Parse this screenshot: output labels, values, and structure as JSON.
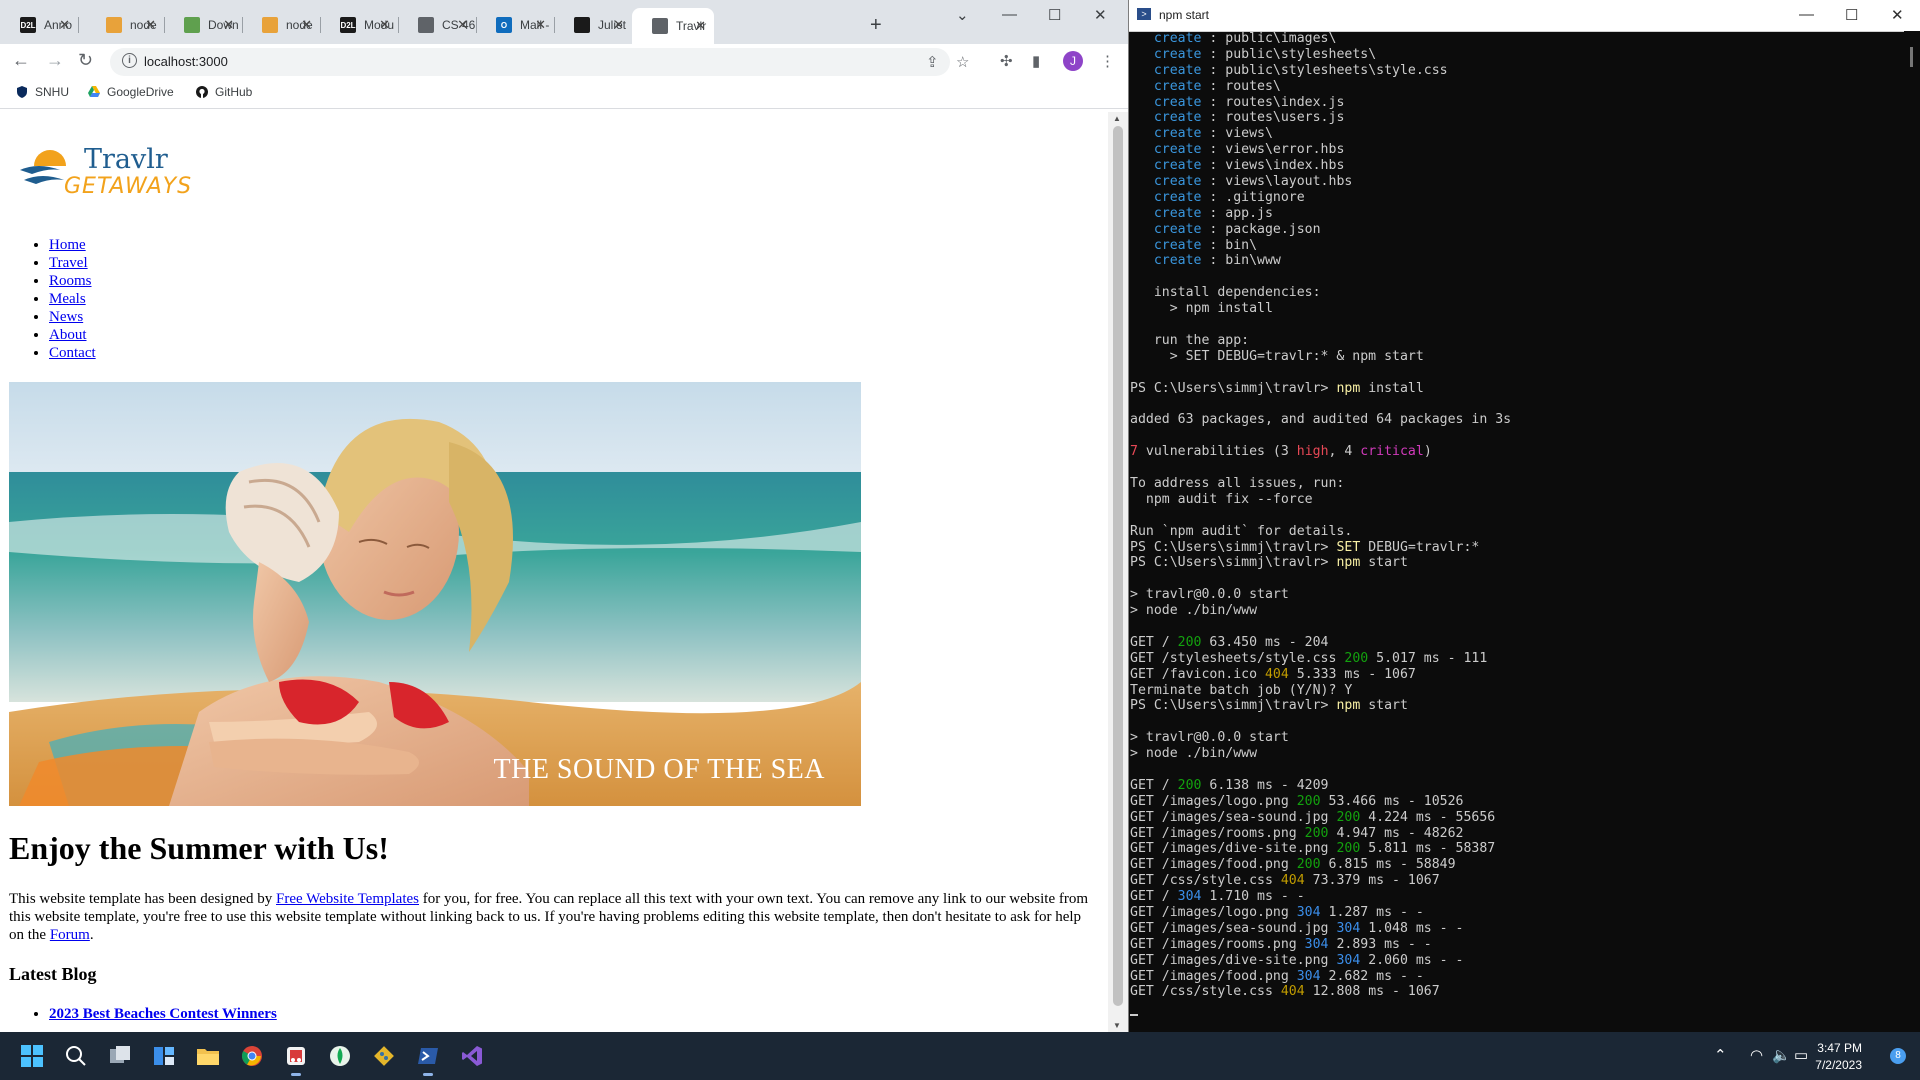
{
  "browser": {
    "tabs": [
      {
        "title": "Anno",
        "icon": "d2l-icon",
        "icon_text": "D2L",
        "icon_color": "#1a1a1a"
      },
      {
        "title": "node",
        "icon": "node-icon",
        "icon_text": "",
        "icon_color": "#e8a23a"
      },
      {
        "title": "Down",
        "icon": "nodejs-hex-icon",
        "icon_text": "",
        "icon_color": "#5fa04e"
      },
      {
        "title": "node",
        "icon": "node-icon",
        "icon_text": "",
        "icon_color": "#e8a23a"
      },
      {
        "title": "Modu",
        "icon": "d2l-icon",
        "icon_text": "D2L",
        "icon_color": "#1a1a1a"
      },
      {
        "title": "CS 46",
        "icon": "globe-icon",
        "icon_text": "",
        "icon_color": "#5f6368"
      },
      {
        "title": "Mail -",
        "icon": "outlook-icon",
        "icon_text": "O",
        "icon_color": "#0f6cbd"
      },
      {
        "title": "Juliet",
        "icon": "github-icon",
        "icon_text": "",
        "icon_color": "#1a1a1a"
      },
      {
        "title": "Travlr",
        "icon": "globe-icon",
        "icon_text": "",
        "icon_color": "#5f6368",
        "active": true
      }
    ],
    "url": "localhost:3000",
    "profile_initial": "J",
    "bookmarks": [
      {
        "label": "SNHU",
        "icon": "snhu-shield-icon"
      },
      {
        "label": "GoogleDrive",
        "icon": "google-drive-icon"
      },
      {
        "label": "GitHub",
        "icon": "github-icon"
      }
    ]
  },
  "page": {
    "logo_top": "Travlr",
    "logo_bottom": "GETAWAYS",
    "nav": [
      "Home",
      "Travel",
      "Rooms",
      "Meals",
      "News",
      "About",
      "Contact"
    ],
    "hero_caption": "THE SOUND OF THE SEA",
    "heading": "Enjoy the Summer with Us!",
    "intro_before_link": "This website template has been designed by ",
    "intro_link": "Free Website Templates",
    "intro_middle": " for you, for free. You can replace all this text with your own text. You can remove any link to our website from this website template, you're free to use this website template without linking back to us. If you're having problems editing this website template, then don't hesitate to ask for help on the ",
    "intro_link2": "Forum",
    "intro_end": ".",
    "latest_blog": "Latest Blog",
    "blog_items": [
      "2023 Best Beaches Contest Winners"
    ]
  },
  "terminal": {
    "title": "npm start",
    "lines": [
      [
        {
          "t": "   "
        },
        {
          "t": "create",
          "c": "c-cyan"
        },
        {
          "t": " : public\\images\\"
        }
      ],
      [
        {
          "t": "   "
        },
        {
          "t": "create",
          "c": "c-cyan"
        },
        {
          "t": " : public\\stylesheets\\"
        }
      ],
      [
        {
          "t": "   "
        },
        {
          "t": "create",
          "c": "c-cyan"
        },
        {
          "t": " : public\\stylesheets\\style.css"
        }
      ],
      [
        {
          "t": "   "
        },
        {
          "t": "create",
          "c": "c-cyan"
        },
        {
          "t": " : routes\\"
        }
      ],
      [
        {
          "t": "   "
        },
        {
          "t": "create",
          "c": "c-cyan"
        },
        {
          "t": " : routes\\index.js"
        }
      ],
      [
        {
          "t": "   "
        },
        {
          "t": "create",
          "c": "c-cyan"
        },
        {
          "t": " : routes\\users.js"
        }
      ],
      [
        {
          "t": "   "
        },
        {
          "t": "create",
          "c": "c-cyan"
        },
        {
          "t": " : views\\"
        }
      ],
      [
        {
          "t": "   "
        },
        {
          "t": "create",
          "c": "c-cyan"
        },
        {
          "t": " : views\\error.hbs"
        }
      ],
      [
        {
          "t": "   "
        },
        {
          "t": "create",
          "c": "c-cyan"
        },
        {
          "t": " : views\\index.hbs"
        }
      ],
      [
        {
          "t": "   "
        },
        {
          "t": "create",
          "c": "c-cyan"
        },
        {
          "t": " : views\\layout.hbs"
        }
      ],
      [
        {
          "t": "   "
        },
        {
          "t": "create",
          "c": "c-cyan"
        },
        {
          "t": " : .gitignore"
        }
      ],
      [
        {
          "t": "   "
        },
        {
          "t": "create",
          "c": "c-cyan"
        },
        {
          "t": " : app.js"
        }
      ],
      [
        {
          "t": "   "
        },
        {
          "t": "create",
          "c": "c-cyan"
        },
        {
          "t": " : package.json"
        }
      ],
      [
        {
          "t": "   "
        },
        {
          "t": "create",
          "c": "c-cyan"
        },
        {
          "t": " : bin\\"
        }
      ],
      [
        {
          "t": "   "
        },
        {
          "t": "create",
          "c": "c-cyan"
        },
        {
          "t": " : bin\\www"
        }
      ],
      [
        {
          "t": ""
        }
      ],
      [
        {
          "t": "   install dependencies:"
        }
      ],
      [
        {
          "t": "     > npm install"
        }
      ],
      [
        {
          "t": ""
        }
      ],
      [
        {
          "t": "   run the app:"
        }
      ],
      [
        {
          "t": "     > SET DEBUG=travlr:* & npm start"
        }
      ],
      [
        {
          "t": ""
        }
      ],
      [
        {
          "t": "PS C:\\Users\\simmj\\travlr> "
        },
        {
          "t": "npm",
          "c": "c-yellow"
        },
        {
          "t": " install"
        }
      ],
      [
        {
          "t": ""
        }
      ],
      [
        {
          "t": "added 63 packages, and audited 64 packages in 3s"
        }
      ],
      [
        {
          "t": ""
        }
      ],
      [
        {
          "t": "7",
          "c": "c-red"
        },
        {
          "t": " vulnerabilities (3 "
        },
        {
          "t": "high",
          "c": "c-red"
        },
        {
          "t": ", 4 "
        },
        {
          "t": "critical",
          "c": "c-mag"
        },
        {
          "t": ")"
        }
      ],
      [
        {
          "t": ""
        }
      ],
      [
        {
          "t": "To address all issues, run:"
        }
      ],
      [
        {
          "t": "  npm audit fix --force"
        }
      ],
      [
        {
          "t": ""
        }
      ],
      [
        {
          "t": "Run `npm audit` for details."
        }
      ],
      [
        {
          "t": "PS C:\\Users\\simmj\\travlr> "
        },
        {
          "t": "SET",
          "c": "c-yellow"
        },
        {
          "t": " DEBUG=travlr:*"
        }
      ],
      [
        {
          "t": "PS C:\\Users\\simmj\\travlr> "
        },
        {
          "t": "npm",
          "c": "c-yellow"
        },
        {
          "t": " start"
        }
      ],
      [
        {
          "t": ""
        }
      ],
      [
        {
          "t": "> travlr@0.0.0 start"
        }
      ],
      [
        {
          "t": "> node ./bin/www"
        }
      ],
      [
        {
          "t": ""
        }
      ],
      [
        {
          "t": "GET / "
        },
        {
          "t": "200",
          "c": "c-green"
        },
        {
          "t": " 63.450 ms - 204"
        }
      ],
      [
        {
          "t": "GET /stylesheets/style.css "
        },
        {
          "t": "200",
          "c": "c-green"
        },
        {
          "t": " 5.017 ms - 111"
        }
      ],
      [
        {
          "t": "GET /favicon.ico "
        },
        {
          "t": "404",
          "c": "c-orange"
        },
        {
          "t": " 5.333 ms - 1067"
        }
      ],
      [
        {
          "t": "Terminate batch job (Y/N)? Y"
        }
      ],
      [
        {
          "t": "PS C:\\Users\\simmj\\travlr> "
        },
        {
          "t": "npm",
          "c": "c-yellow"
        },
        {
          "t": " start"
        }
      ],
      [
        {
          "t": ""
        }
      ],
      [
        {
          "t": "> travlr@0.0.0 start"
        }
      ],
      [
        {
          "t": "> node ./bin/www"
        }
      ],
      [
        {
          "t": ""
        }
      ],
      [
        {
          "t": "GET / "
        },
        {
          "t": "200",
          "c": "c-green"
        },
        {
          "t": " 6.138 ms - 4209"
        }
      ],
      [
        {
          "t": "GET /images/logo.png "
        },
        {
          "t": "200",
          "c": "c-green"
        },
        {
          "t": " 53.466 ms - 10526"
        }
      ],
      [
        {
          "t": "GET /images/sea-sound.jpg "
        },
        {
          "t": "200",
          "c": "c-green"
        },
        {
          "t": " 4.224 ms - 55656"
        }
      ],
      [
        {
          "t": "GET /images/rooms.png "
        },
        {
          "t": "200",
          "c": "c-green"
        },
        {
          "t": " 4.947 ms - 48262"
        }
      ],
      [
        {
          "t": "GET /images/dive-site.png "
        },
        {
          "t": "200",
          "c": "c-green"
        },
        {
          "t": " 5.811 ms - 58387"
        }
      ],
      [
        {
          "t": "GET /images/food.png "
        },
        {
          "t": "200",
          "c": "c-green"
        },
        {
          "t": " 6.815 ms - 58849"
        }
      ],
      [
        {
          "t": "GET /css/style.css "
        },
        {
          "t": "404",
          "c": "c-orange"
        },
        {
          "t": " 73.379 ms - 1067"
        }
      ],
      [
        {
          "t": "GET / "
        },
        {
          "t": "304",
          "c": "c-blue"
        },
        {
          "t": " 1.710 ms - -"
        }
      ],
      [
        {
          "t": "GET /images/logo.png "
        },
        {
          "t": "304",
          "c": "c-blue"
        },
        {
          "t": " 1.287 ms - -"
        }
      ],
      [
        {
          "t": "GET /images/sea-sound.jpg "
        },
        {
          "t": "304",
          "c": "c-blue"
        },
        {
          "t": " 1.048 ms - -"
        }
      ],
      [
        {
          "t": "GET /images/rooms.png "
        },
        {
          "t": "304",
          "c": "c-blue"
        },
        {
          "t": " 2.893 ms - -"
        }
      ],
      [
        {
          "t": "GET /images/dive-site.png "
        },
        {
          "t": "304",
          "c": "c-blue"
        },
        {
          "t": " 2.060 ms - -"
        }
      ],
      [
        {
          "t": "GET /images/food.png "
        },
        {
          "t": "304",
          "c": "c-blue"
        },
        {
          "t": " 2.682 ms - -"
        }
      ],
      [
        {
          "t": "GET /css/style.css "
        },
        {
          "t": "404",
          "c": "c-orange"
        },
        {
          "t": " 12.808 ms - 1067"
        }
      ]
    ]
  },
  "taskbar": {
    "apps": [
      "start-icon",
      "search-icon",
      "task-view-icon",
      "widgets-icon",
      "file-explorer-icon",
      "chrome-icon",
      "snipping-tool-icon",
      "mongodb-compass-icon",
      "git-icon",
      "powershell-icon",
      "visual-studio-icon"
    ],
    "time": "3:47 PM",
    "date": "7/2/2023",
    "notification_count": "8"
  }
}
